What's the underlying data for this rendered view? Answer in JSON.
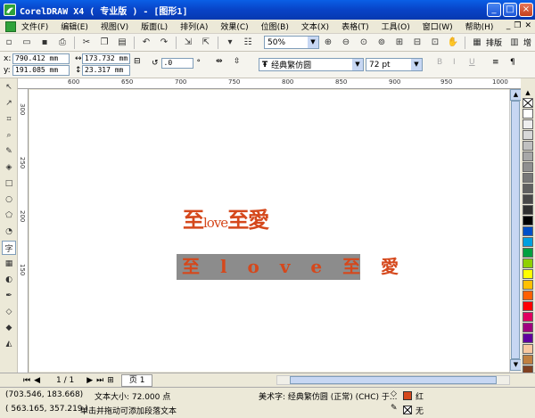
{
  "window": {
    "title": "CorelDRAW X4 ( 专业版 ) - [图形1]",
    "min_label": "_",
    "max_label": "□",
    "close_label": "×"
  },
  "menu": [
    "文件(F)",
    "编辑(E)",
    "视图(V)",
    "版面(L)",
    "排列(A)",
    "效果(C)",
    "位图(B)",
    "文本(X)",
    "表格(T)",
    "工具(O)",
    "窗口(W)",
    "帮助(H)"
  ],
  "toolbar": {
    "zoom_value": "50%",
    "layout_label": "排版",
    "extra_label": "增"
  },
  "propbar": {
    "x_label": "x:",
    "x_value": "790.412 mm",
    "y_label": "y:",
    "y_value": "191.085 mm",
    "w_value": "173.732 mm",
    "h_value": "23.317 mm",
    "rotation_value": ".0",
    "rotation_unit": "°",
    "font_name": "经典繁仿圆",
    "font_size": "72 pt"
  },
  "rulers": {
    "h_ticks": [
      "600",
      "650",
      "700",
      "750",
      "800",
      "850",
      "900",
      "950",
      "1000"
    ],
    "v_ticks": [
      "300",
      "250",
      "200",
      "150"
    ]
  },
  "canvas": {
    "text1_part1": "至",
    "text1_part2": "love",
    "text1_part3": "至愛",
    "text2": "至 l o v e 至 愛"
  },
  "pagenav": {
    "page_count": "1 / 1",
    "page_tab": "页 1"
  },
  "status": {
    "coords1": "(703.546, 183.668)",
    "text_size": "文本大小: 72.000 点",
    "coords2": "( 563.165, 357.219 )",
    "hint": "单击并拖动可添加段落文本",
    "font_info": "美术字: 经典繁仿圆 (正常) (CHC) 于...",
    "fill_label": "红",
    "outline_label": "无"
  },
  "colors": {
    "accent": "#d5481c",
    "palette": [
      "#ffffff",
      "#eeeeee",
      "#d8d8d8",
      "#c0c0c0",
      "#a8a8a8",
      "#909090",
      "#787878",
      "#606060",
      "#484848",
      "#303030",
      "#000000",
      "#0050c8",
      "#00a0e0",
      "#00a040",
      "#90d000",
      "#ffff00",
      "#ffc000",
      "#ff6000",
      "#ff0000",
      "#e00060",
      "#a00080",
      "#6000a0",
      "#f8c8a0",
      "#c08040",
      "#804020",
      "#f0e0c0",
      "#ffe0e0"
    ]
  }
}
